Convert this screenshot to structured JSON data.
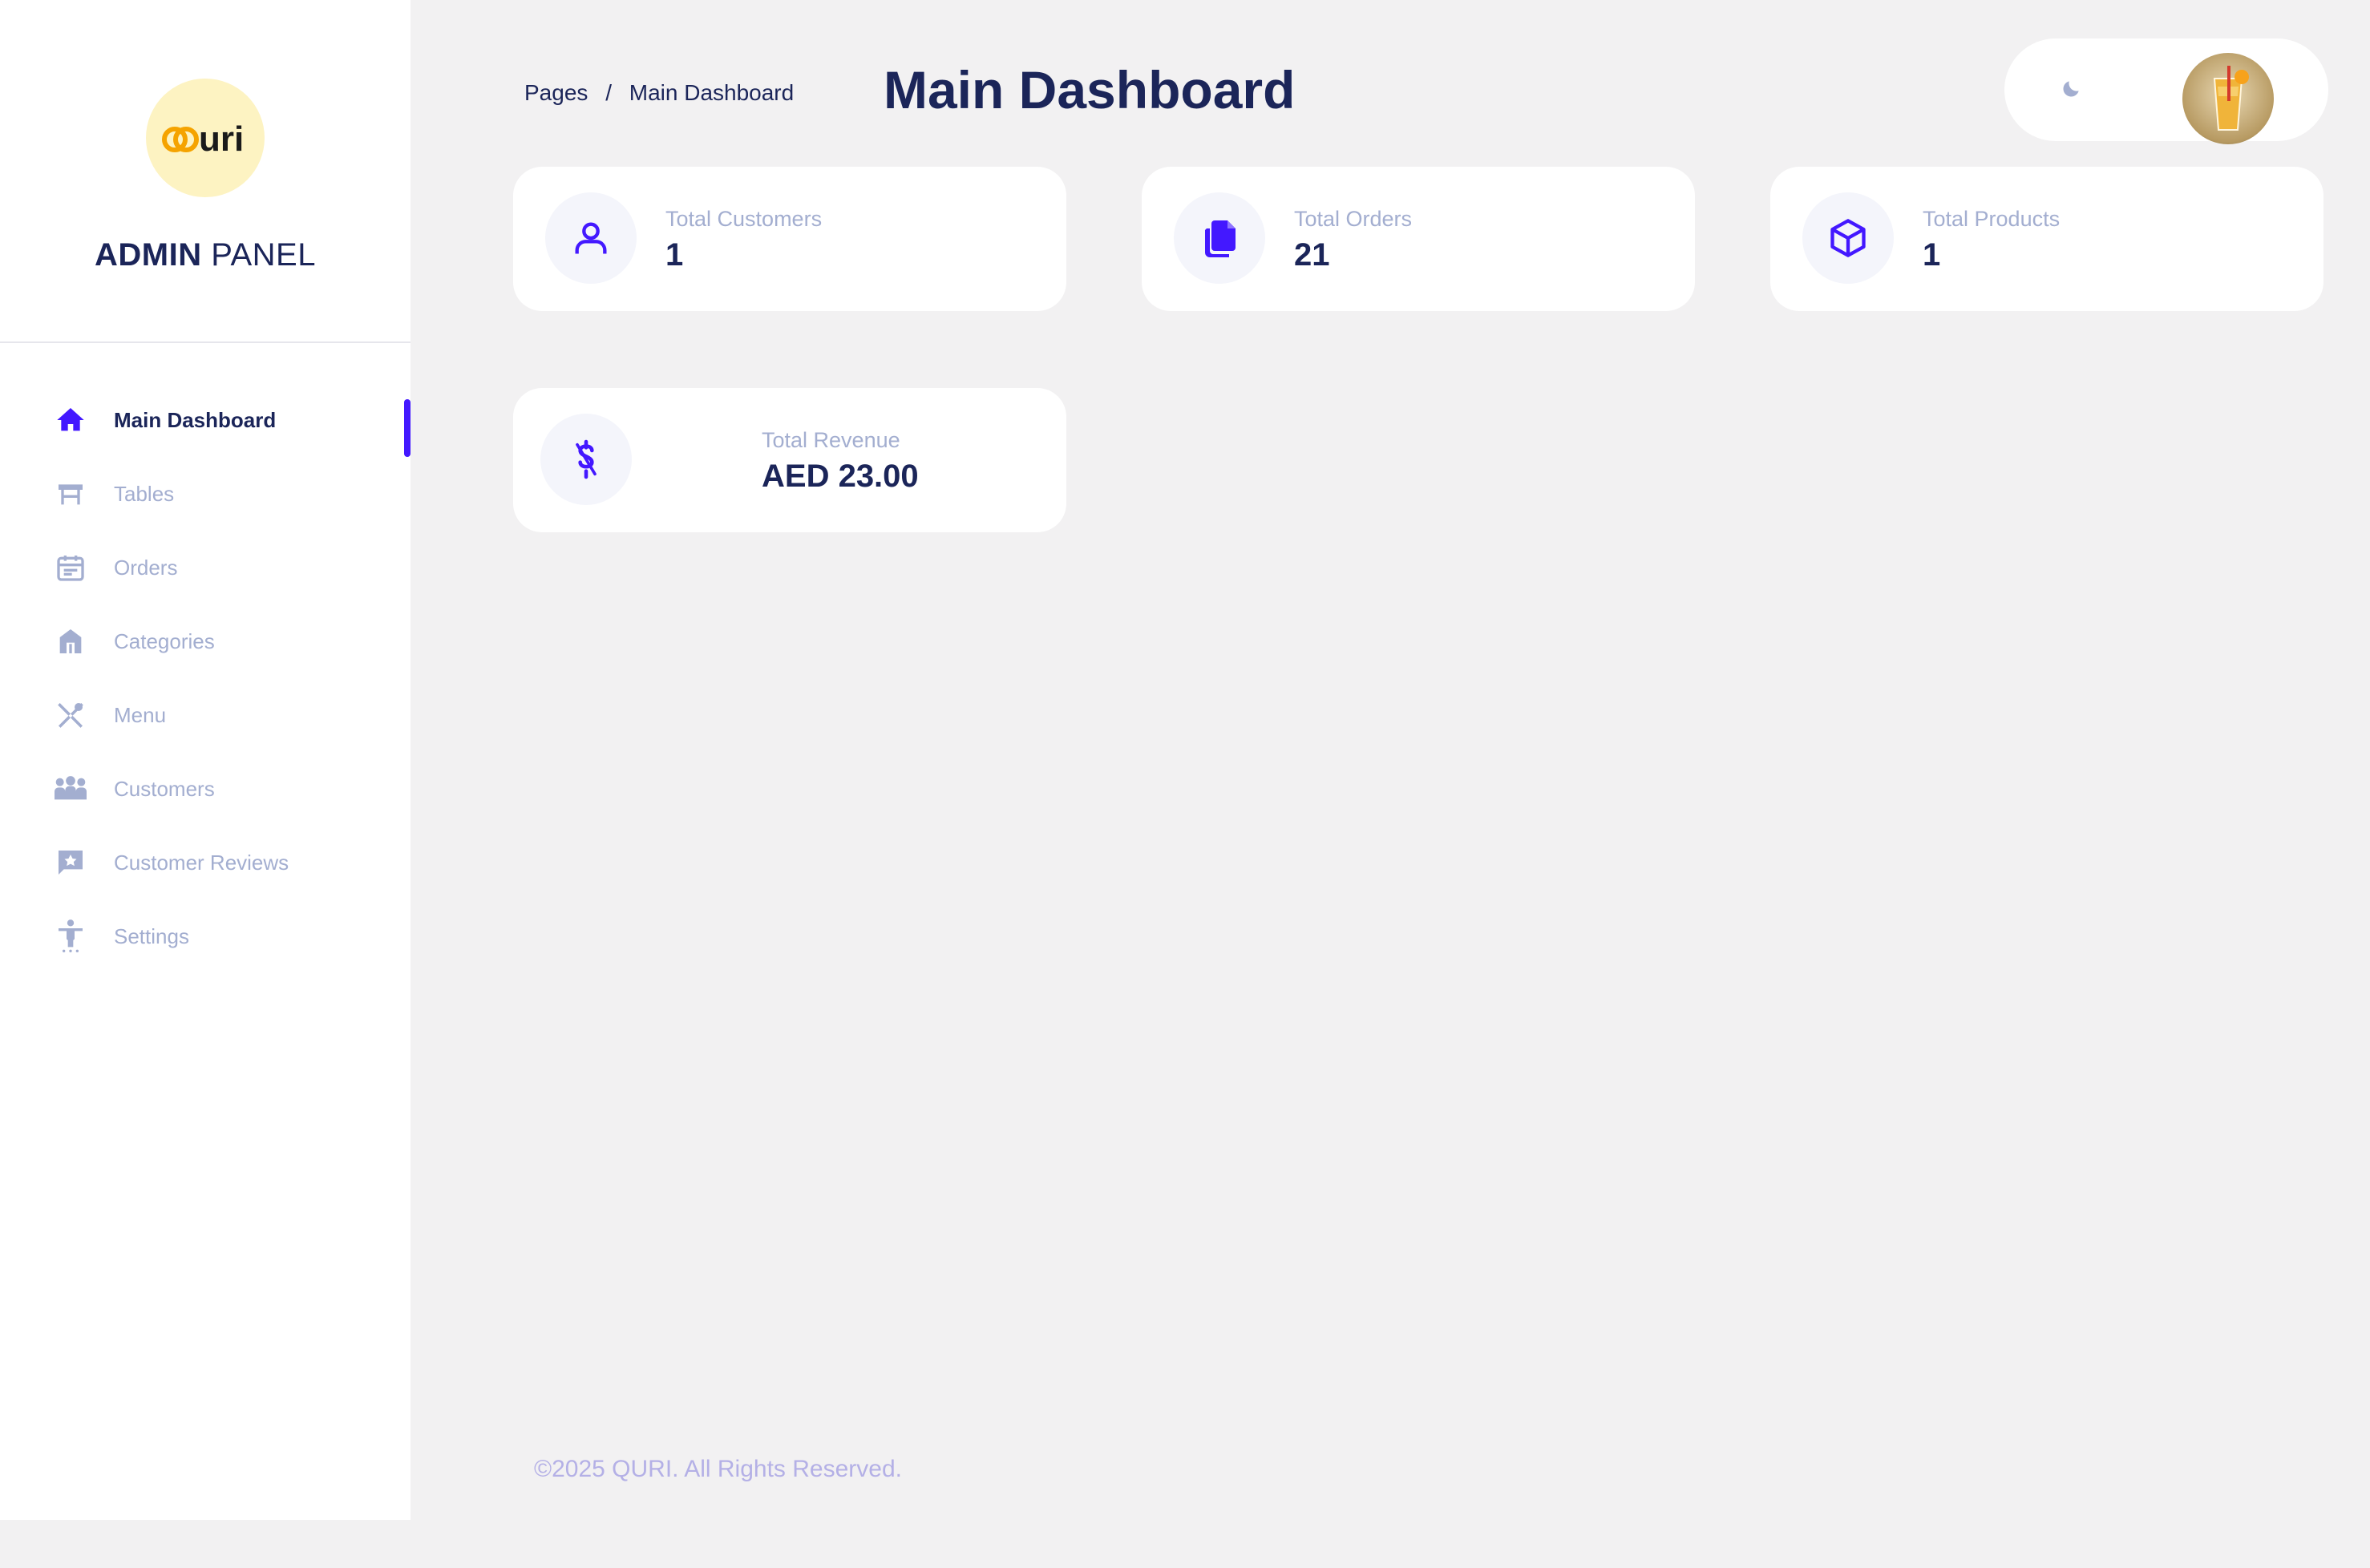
{
  "brand": {
    "logo_text": "Quri",
    "title_bold": "ADMIN",
    "title_rest": "PANEL"
  },
  "sidebar": {
    "items": [
      {
        "label": "Main Dashboard",
        "icon": "home-icon",
        "active": true
      },
      {
        "label": "Tables",
        "icon": "table-icon",
        "active": false
      },
      {
        "label": "Orders",
        "icon": "calendar-icon",
        "active": false
      },
      {
        "label": "Categories",
        "icon": "store-icon",
        "active": false
      },
      {
        "label": "Menu",
        "icon": "utensils-icon",
        "active": false
      },
      {
        "label": "Customers",
        "icon": "people-icon",
        "active": false
      },
      {
        "label": "Customer Reviews",
        "icon": "review-icon",
        "active": false
      },
      {
        "label": "Settings",
        "icon": "accessibility-icon",
        "active": false
      }
    ]
  },
  "header": {
    "breadcrumb_root": "Pages",
    "breadcrumb_separator": "/",
    "breadcrumb_current": "Main Dashboard",
    "title": "Main Dashboard"
  },
  "topbar": {
    "theme_icon": "moon-icon",
    "avatar_icon": "drink-avatar"
  },
  "stats": [
    {
      "label": "Total Customers",
      "value": "1",
      "icon": "user-icon"
    },
    {
      "label": "Total Orders",
      "value": "21",
      "icon": "documents-icon"
    },
    {
      "label": "Total Products",
      "value": "1",
      "icon": "cube-icon"
    },
    {
      "label": "Total Revenue",
      "value": "AED 23.00",
      "icon": "dollar-icon"
    }
  ],
  "footer": {
    "text": "©2025 QURI. All Rights Reserved."
  },
  "colors": {
    "accent": "#4318ff",
    "text_primary": "#1b2559",
    "text_muted": "#a3aed0",
    "background": "#f2f1f2",
    "logo_bg": "#fdf3c2",
    "logo_accent": "#f5a300"
  }
}
